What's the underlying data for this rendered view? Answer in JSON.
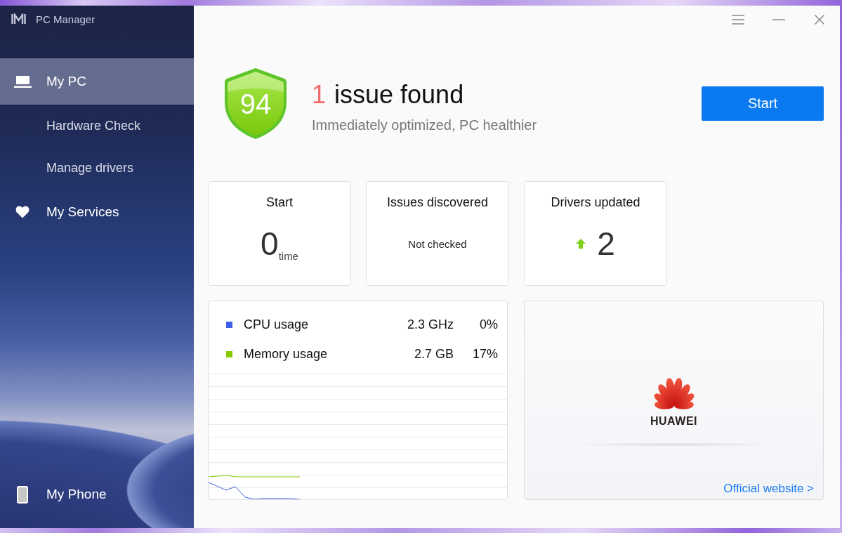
{
  "window": {
    "title": "PC Manager"
  },
  "sidebar": {
    "items": [
      {
        "label": "My PC",
        "selected": true,
        "children": [
          {
            "label": "Hardware Check",
            "selected": false
          },
          {
            "label": "Manage drivers",
            "selected": false
          }
        ]
      },
      {
        "label": "My Services",
        "selected": false
      }
    ],
    "footer": {
      "label": "My Phone",
      "selected": false
    }
  },
  "health": {
    "score": "94",
    "issue_count": "1",
    "headline": "issue found",
    "subtitle": "Immediately optimized, PC healthier",
    "button": "Start"
  },
  "stats": [
    {
      "kind": "count",
      "title": "Start",
      "value": "0",
      "unit": "time"
    },
    {
      "kind": "status",
      "title": "Issues discovered",
      "value": "Not checked"
    },
    {
      "kind": "increase",
      "title": "Drivers updated",
      "value": "2"
    }
  ],
  "usage": {
    "rows": [
      {
        "label": "CPU usage",
        "color": "#3f5ee8",
        "reading": "2.3 GHz",
        "percent": "0%"
      },
      {
        "label": "Memory usage",
        "color": "#88cc00",
        "reading": "2.7 GB",
        "percent": "17%"
      }
    ]
  },
  "promo": {
    "logo_text": "HUAWEI",
    "link": "Official website >"
  }
}
